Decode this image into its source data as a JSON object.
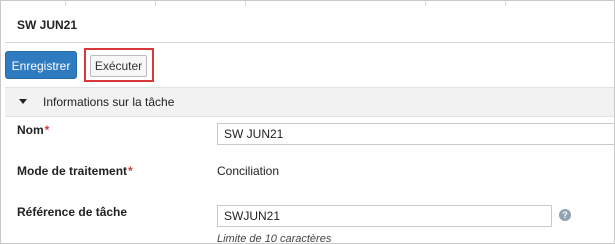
{
  "header": {
    "title": "SW JUN21"
  },
  "toolbar": {
    "save_label": "Enregistrer",
    "run_label": "Exécuter"
  },
  "section": {
    "title": "Informations sur la tâche"
  },
  "form": {
    "name": {
      "label": "Nom",
      "required_mark": "*",
      "value": "SW JUN21"
    },
    "mode": {
      "label": "Mode de traitement",
      "required_mark": "*",
      "value": "Conciliation"
    },
    "reference": {
      "label": "Référence de tâche",
      "value": "SWJUN21",
      "hint": "Limite de 10 caractères"
    }
  },
  "icons": {
    "help": "?"
  },
  "colors": {
    "primary": "#2f7bbf",
    "highlight": "#d9383a",
    "required": "#d9383a"
  }
}
